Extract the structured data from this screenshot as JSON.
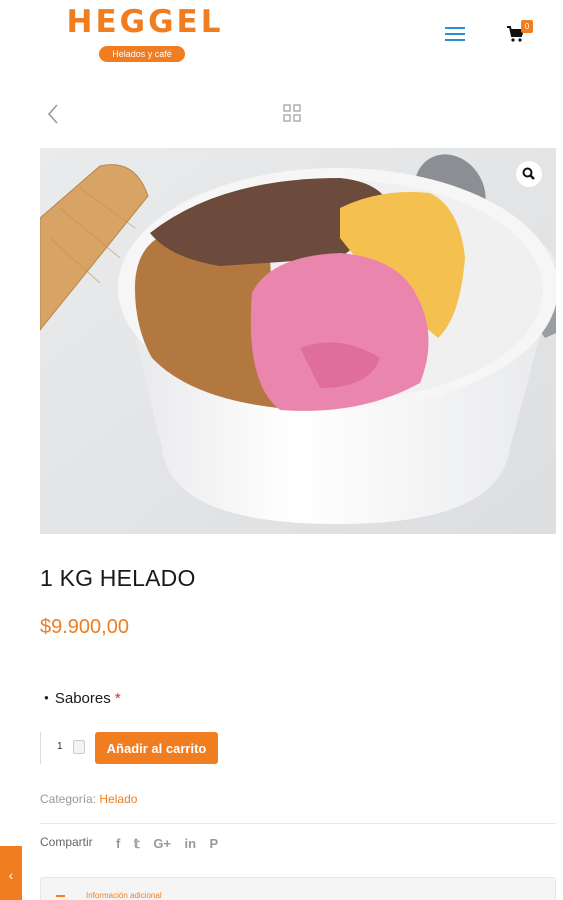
{
  "header": {
    "logo_text": "HEGGEL",
    "logo_tagline": "Helados y café",
    "cart_count": "0"
  },
  "product": {
    "title": "1 KG HELADO",
    "price": "$9.900,00",
    "variation_label": "Sabores",
    "variation_required_mark": "*",
    "quantity": "1",
    "add_to_cart_label": "Añadir al carrito",
    "category_label": "Categoría:",
    "category_value": "Helado",
    "share_label": "Compartir",
    "share_icons": [
      "facebook-icon",
      "twitter-icon",
      "google-plus-icon",
      "linkedin-icon",
      "pinterest-icon"
    ],
    "share_glyphs": [
      "f",
      "𝕥",
      "G+",
      "in",
      "P"
    ]
  },
  "accordion": {
    "label": "Información adicional"
  },
  "colors": {
    "accent": "#f07d1f",
    "menu_blue": "#2b8fd6",
    "required_red": "#e02b2b"
  }
}
